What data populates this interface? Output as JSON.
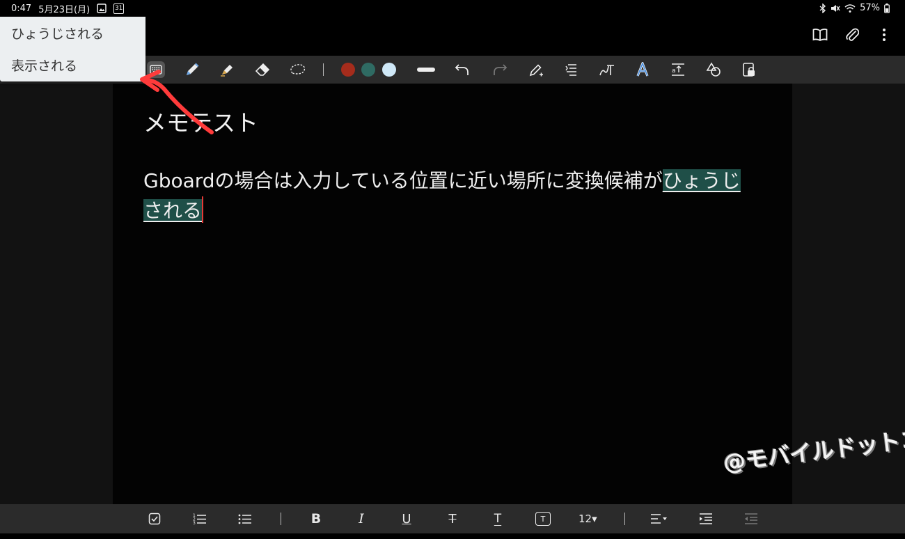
{
  "status_bar": {
    "time": "0:47",
    "date": "5月23日(月)",
    "calendar_badge": "31",
    "battery": "57%"
  },
  "suggestions": {
    "items": [
      {
        "label": "ひょうじされる"
      },
      {
        "label": "表示される"
      }
    ]
  },
  "toolbar": {
    "colors": [
      "#a52c1c",
      "#2f6b63",
      "#cfe8f7"
    ]
  },
  "note": {
    "title": "メモテスト",
    "body_text": "Gboardの場合は入力している位置に近い場所に変換候補が",
    "composing_text": "ひょうじされる"
  },
  "format_bar": {
    "bold": "B",
    "italic": "I",
    "underline": "U",
    "strike": "T",
    "text_color": "T",
    "text_box": "T",
    "font_size": "12▾"
  },
  "watermark": "@モバイルドットコム",
  "colors": {
    "annotation_arrow": "#ff3b3b",
    "composing_bg": "#1f4f48",
    "caret": "#e53935"
  }
}
